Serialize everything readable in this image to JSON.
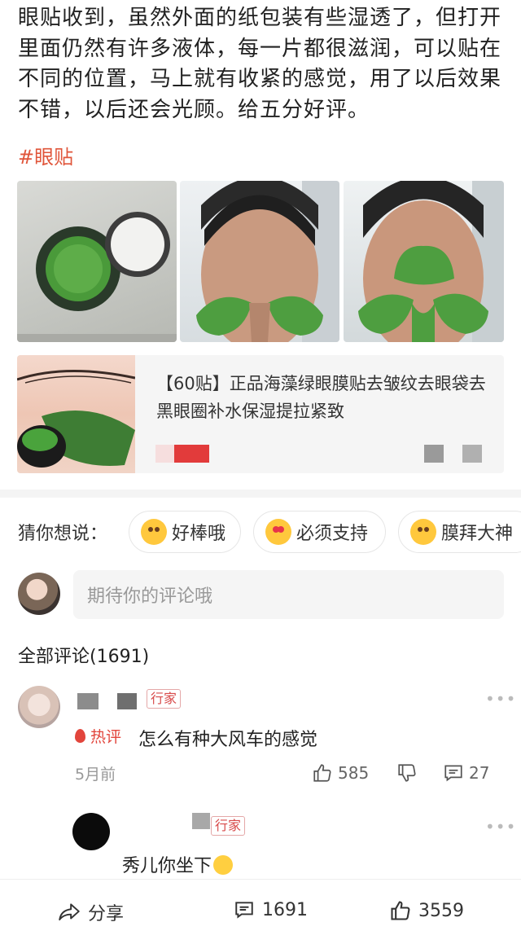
{
  "post": {
    "text": "眼贴收到，虽然外面的纸包装有些湿透了，但打开里面仍然有许多液体，每一片都很滋润，可以贴在不同的位置，马上就有收紧的感觉，用了以后效果不错，以后还会光顾。给五分好评。",
    "hashtag": "#眼贴"
  },
  "product": {
    "title": "【60贴】正品海藻绿眼膜贴去皱纹去眼袋去黑眼圈补水保湿提拉紧致"
  },
  "suggestions": {
    "label": "猜你想说：",
    "chips": [
      {
        "text": "好棒哦",
        "icon": "blush-emoji-icon"
      },
      {
        "text": "必须支持",
        "icon": "heart-eyes-emoji-icon"
      },
      {
        "text": "膜拜大神",
        "icon": "praise-emoji-icon"
      }
    ]
  },
  "comment_box": {
    "placeholder": "期待你的评论哦"
  },
  "comments_header": "全部评论(1691)",
  "comments": [
    {
      "tag": "行家",
      "badge": "热评",
      "text": "怎么有种大风车的感觉",
      "time": "5月前",
      "likes": "585",
      "replies": "27"
    },
    {
      "tag": "行家",
      "text": "秀儿你坐下"
    }
  ],
  "bottom_bar": {
    "share": "分享",
    "comments": "1691",
    "likes": "3559"
  },
  "colors": {
    "accent": "#e0553a",
    "hot": "#e2453c",
    "eye_patch": "#3e8e3a"
  }
}
